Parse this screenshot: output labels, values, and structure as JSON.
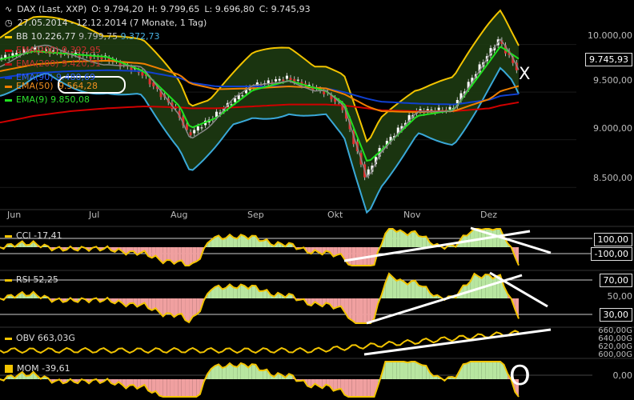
{
  "header": {
    "symbol": "DAX (Last, XXP)",
    "open": "O: 9.794,20",
    "high": "H: 9.799,65",
    "low": "L: 9.696,80",
    "close": "C: 9.745,93",
    "period": "27.05.2014 - 12.12.2014 (7 Monate, 1 Tag)"
  },
  "legend": [
    {
      "label": "BB",
      "value": "10.226,77",
      "value2": "9.799,75",
      "value3": "9.372,73",
      "color": "#f2c400"
    },
    {
      "label": "EMA(200)",
      "value": "9.392,95",
      "color": "#d00000"
    },
    {
      "label": "EMA(200)",
      "value": "9.420,51",
      "color": "#b01010"
    },
    {
      "label": "EMA(90)",
      "value": "9.480,69",
      "color": "#1040d0"
    },
    {
      "label": "EMA(50)",
      "value": "9.564,28",
      "color": "#f08000"
    },
    {
      "label": "EMA(9)",
      "value": "9.850,08",
      "color": "#20e020"
    }
  ],
  "price_axis": [
    "10.000,00",
    "9.500,00",
    "9.000,00",
    "8.500,00"
  ],
  "last_price": "9.745,93",
  "x_labels": [
    "Jun",
    "Jul",
    "Aug",
    "Sep",
    "Okt",
    "Nov",
    "Dez"
  ],
  "annotations": {
    "x_mark": "X",
    "o_mark": "O"
  },
  "cci": {
    "label": "CCI",
    "value": "-17,41",
    "levels": [
      "100,00",
      "-100,00"
    ]
  },
  "rsi": {
    "label": "RSI",
    "value": "52,25",
    "levels": [
      "70,00",
      "50,00",
      "30,00"
    ]
  },
  "obv": {
    "label": "OBV",
    "value": "663,03G",
    "levels": [
      "660,00G",
      "640,00G",
      "620,00G",
      "600,00G"
    ]
  },
  "mom": {
    "label": "MOM",
    "value": "-39,61",
    "levels": [
      "0,00"
    ]
  },
  "chart_data": {
    "type": "line",
    "title": "DAX (Last, XXP)",
    "xlabel": "",
    "ylabel": "",
    "ylim": [
      8300,
      10400
    ],
    "grid": true,
    "x": [
      "2014-05-27",
      "2014-06-09",
      "2014-06-23",
      "2014-07-07",
      "2014-07-21",
      "2014-08-04",
      "2014-08-08",
      "2014-08-18",
      "2014-09-01",
      "2014-09-15",
      "2014-09-29",
      "2014-10-06",
      "2014-10-15",
      "2014-10-20",
      "2014-11-03",
      "2014-11-17",
      "2014-12-01",
      "2014-12-05",
      "2014-12-12"
    ],
    "series": [
      {
        "name": "Close",
        "values": [
          9850,
          9950,
          9900,
          9860,
          9700,
          9280,
          9050,
          9250,
          9560,
          9650,
          9500,
          9350,
          8600,
          8880,
          9300,
          9320,
          9900,
          10050,
          9745.93
        ]
      },
      {
        "name": "EMA(200)",
        "values": [
          9180,
          9250,
          9300,
          9330,
          9350,
          9340,
          9330,
          9330,
          9350,
          9370,
          9370,
          9360,
          9330,
          9310,
          9300,
          9300,
          9330,
          9360,
          9392.95
        ]
      },
      {
        "name": "EMA(90)",
        "values": [
          9650,
          9700,
          9720,
          9730,
          9720,
          9650,
          9600,
          9560,
          9560,
          9560,
          9540,
          9500,
          9430,
          9400,
          9380,
          9370,
          9420,
          9460,
          9480.69
        ]
      },
      {
        "name": "EMA(50)",
        "values": [
          9720,
          9790,
          9820,
          9830,
          9800,
          9680,
          9590,
          9530,
          9540,
          9560,
          9540,
          9480,
          9350,
          9300,
          9290,
          9300,
          9430,
          9510,
          9564.28
        ]
      },
      {
        "name": "EMA(9)",
        "values": [
          9840,
          9930,
          9900,
          9870,
          9720,
          9350,
          9120,
          9230,
          9520,
          9620,
          9510,
          9380,
          8760,
          8880,
          9250,
          9310,
          9830,
          9980,
          9850.08
        ]
      }
    ],
    "indicators": {
      "cci_last": -17.41,
      "rsi_last": 52.25,
      "obv_last_g": 663.03,
      "mom_last": -39.61
    }
  }
}
